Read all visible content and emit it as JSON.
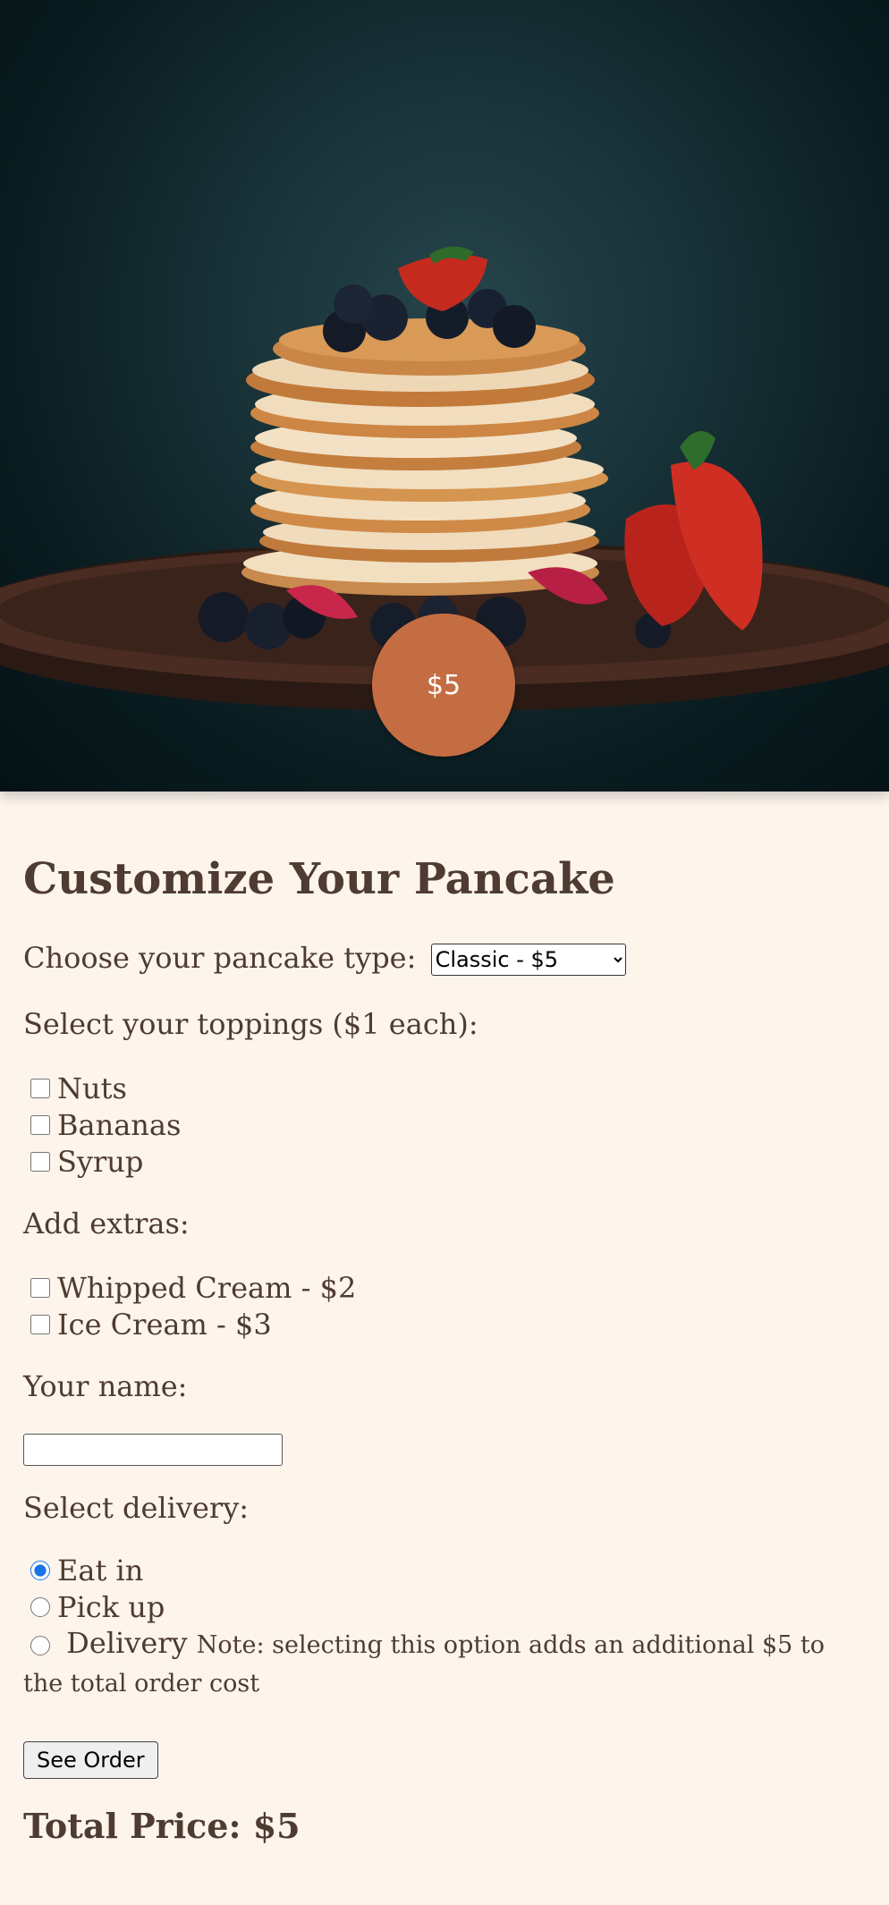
{
  "hero": {
    "image": "pancake-stack-photo",
    "price_badge": "$5"
  },
  "form": {
    "title": "Customize Your Pancake",
    "type_label": "Choose your pancake type:",
    "type_selected": "Classic - $5",
    "toppings_label": "Select your toppings ($1 each):",
    "toppings": [
      "Nuts",
      "Bananas",
      "Syrup"
    ],
    "extras_label": "Add extras:",
    "extras": [
      "Whipped Cream - $2",
      "Ice Cream - $3"
    ],
    "name_label": "Your name:",
    "name_value": "",
    "delivery_label": "Select delivery:",
    "delivery_options": [
      "Eat in",
      "Pick up",
      "Delivery"
    ],
    "delivery_selected": "Eat in",
    "delivery_note": "Note: selecting this option adds an additional $5 to the total order cost",
    "see_order_label": "See Order",
    "total_price": "Total Price: $5"
  },
  "colors": {
    "background": "#fdf4ec",
    "text": "#4e3b31",
    "badge": "#c56d42"
  }
}
